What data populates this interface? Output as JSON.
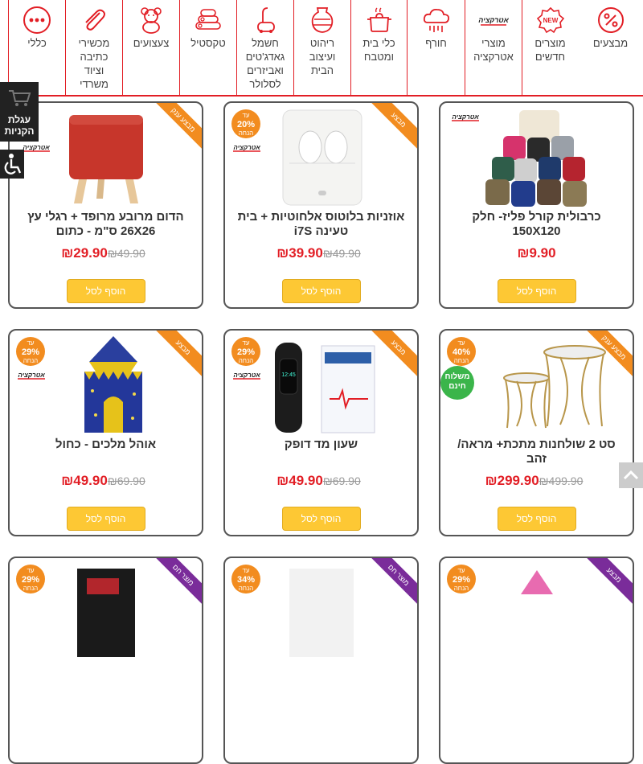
{
  "nav": {
    "categories": [
      {
        "label": "מבצעים",
        "icon": "percent-badge-icon"
      },
      {
        "label": "מוצרים\nחדשים",
        "icon": "new-badge-icon"
      },
      {
        "label": "מוצרי\nאטרקציה",
        "icon": "atraktzia-logo-icon"
      },
      {
        "label": "חורף",
        "icon": "winter-cloud-icon"
      },
      {
        "label": "כלי בית\nומטבח",
        "icon": "cooking-pot-icon"
      },
      {
        "label": "ריהוט\nועיצוב\nהבית",
        "icon": "vase-icon"
      },
      {
        "label": "חשמל\nגאדג'טים\nואביזרים\nלסלולר",
        "icon": "vacuum-cleaner-icon"
      },
      {
        "label": "טקסטיל",
        "icon": "towels-icon"
      },
      {
        "label": "צעצועים",
        "icon": "teddy-bear-icon"
      },
      {
        "label": "מכשירי\nכתיבה\nוציוד\nמשרדי",
        "icon": "paperclip-icon"
      },
      {
        "label": "כללי",
        "icon": "more-dots-icon"
      }
    ]
  },
  "cart": {
    "label": "עגלת\nהקניות"
  },
  "brand_text": "אטרקציה",
  "add_to_cart": "הוסף לסל",
  "products": [
    {
      "name": "כרבולית קורל פליז- חלק 150X120",
      "price": "₪9.90",
      "old": "",
      "ribbon": "",
      "disc": ""
    },
    {
      "name": "אוזניות בלוטוס אלחוטיות + בית טעינה i7S",
      "price": "₪39.90",
      "old": "₪49.90",
      "ribbon": "מבצע",
      "disc": "20%"
    },
    {
      "name": "הדום מרובע מרופד + רגלי עץ 26X26 ס\"מ - כתום",
      "price": "₪29.90",
      "old": "₪49.90",
      "ribbon": "מבצע ענק",
      "disc": ""
    },
    {
      "name": "סט 2 שולחנות מתכת+ מראה/ זהב",
      "price": "₪299.90",
      "old": "₪499.90",
      "ribbon": "מבצע ענק",
      "disc": "40%",
      "free": "משלוח\nחינם"
    },
    {
      "name": "שעון מד דופק",
      "price": "₪49.90",
      "old": "₪69.90",
      "ribbon": "מבצע",
      "disc": "29%"
    },
    {
      "name": "אוהל מלכים - כחול",
      "price": "₪49.90",
      "old": "₪69.90",
      "ribbon": "מבצע",
      "disc": "29%"
    },
    {
      "name": "",
      "price": "",
      "old": "",
      "ribbon": "מוצר חם",
      "disc": "29%"
    },
    {
      "name": "",
      "price": "",
      "old": "",
      "ribbon": "מוצר חם",
      "disc": "34%"
    },
    {
      "name": "",
      "price": "",
      "old": "",
      "ribbon": "מבצע",
      "disc": "29%"
    }
  ],
  "disc_top": "עד",
  "disc_bottom": "הנחה",
  "colors": {
    "accent": "#e21e25",
    "button": "#fdc834",
    "ribbon_orange": "#f28c1f",
    "ribbon_purple": "#7a2c9a",
    "free_ship": "#3bb54a"
  }
}
